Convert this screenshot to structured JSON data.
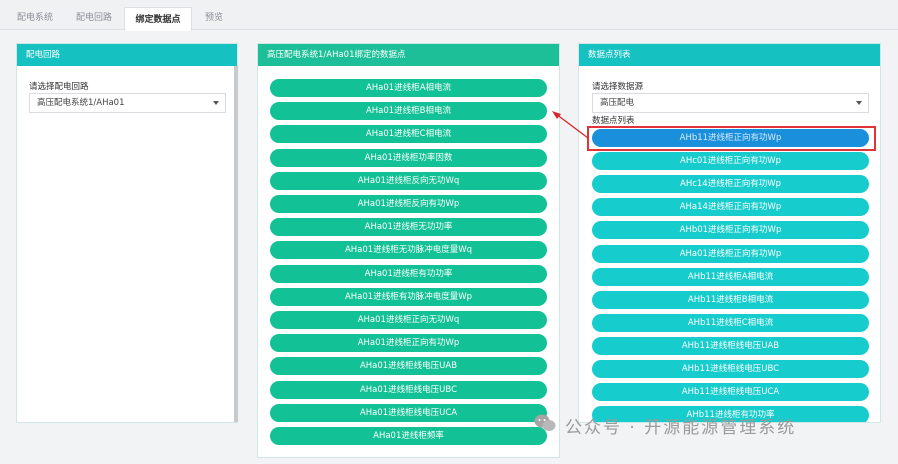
{
  "tabs": [
    {
      "label": "配电系统"
    },
    {
      "label": "配电回路"
    },
    {
      "label": "绑定数据点"
    },
    {
      "label": "预览"
    }
  ],
  "left_panel": {
    "title": "配电回路",
    "field_label": "请选择配电回路",
    "select_value": "高压配电系统1/AHa01"
  },
  "middle_panel": {
    "title": "高压配电系统1/AHa01绑定的数据点",
    "items": [
      "AHa01进线柜A相电流",
      "AHa01进线柜B相电流",
      "AHa01进线柜C相电流",
      "AHa01进线柜功率因数",
      "AHa01进线柜反向无功Wq",
      "AHa01进线柜反向有功Wp",
      "AHa01进线柜无功功率",
      "AHa01进线柜无功脉冲电度量Wq",
      "AHa01进线柜有功功率",
      "AHa01进线柜有功脉冲电度量Wp",
      "AHa01进线柜正向无功Wq",
      "AHa01进线柜正向有功Wp",
      "AHa01进线柜线电压UAB",
      "AHa01进线柜线电压UBC",
      "AHa01进线柜线电压UCA",
      "AHa01进线柜频率"
    ]
  },
  "right_panel": {
    "title": "数据点列表",
    "field_label": "请选择数据源",
    "select_value": "高压配电",
    "list_label": "数据点列表",
    "items": [
      "AHb11进线柜正向有功Wp",
      "AHc01进线柜正向有功Wp",
      "AHc14进线柜正向有功Wp",
      "AHa14进线柜正向有功Wp",
      "AHb01进线柜正向有功Wp",
      "AHa01进线柜正向有功Wp",
      "AHb11进线柜A相电流",
      "AHb11进线柜B相电流",
      "AHb11进线柜C相电流",
      "AHb11进线柜线电压UAB",
      "AHb11进线柜线电压UBC",
      "AHb11进线柜线电压UCA",
      "AHb11进线柜有功功率"
    ],
    "selected_index": 0
  },
  "watermark": "公众号 · 开源能源管理系统",
  "colors": {
    "teal_header": "#16c1c1",
    "green_header": "#1cbf98",
    "green_pill": "#12c195",
    "cyan_pill": "#16cccc",
    "selected_pill": "#1a8fdc",
    "highlight_frame": "#e0343a",
    "arrow": "#d9262c"
  }
}
